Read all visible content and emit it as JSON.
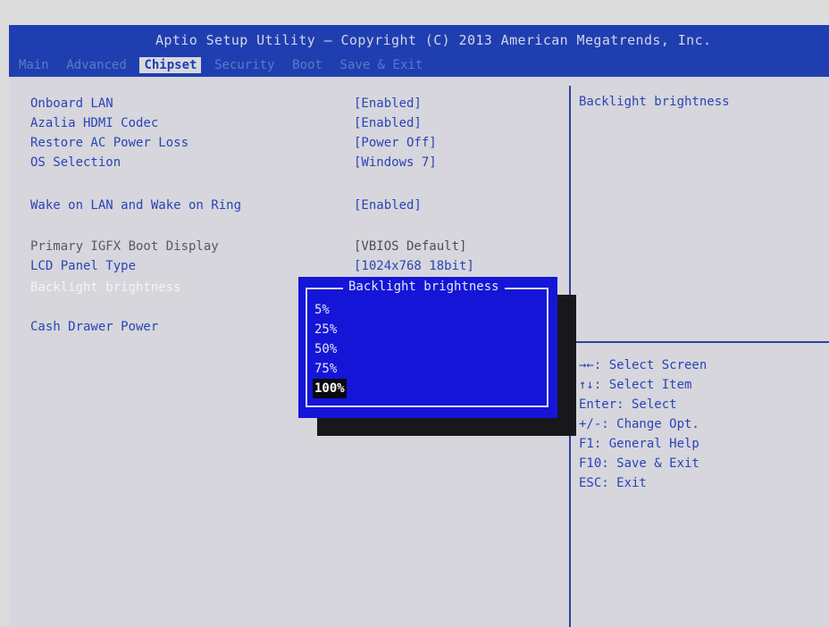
{
  "header": {
    "title": "Aptio Setup Utility – Copyright (C) 2013 American Megatrends, Inc.",
    "tabs": [
      {
        "label": "Main"
      },
      {
        "label": "Advanced"
      },
      {
        "label": "Chipset"
      },
      {
        "label": "Security"
      },
      {
        "label": "Boot"
      },
      {
        "label": "Save & Exit"
      }
    ],
    "active_tab": "Chipset"
  },
  "settings": [
    {
      "label": "Onboard LAN",
      "value": "[Enabled]"
    },
    {
      "label": "Azalia HDMI Codec",
      "value": "[Enabled]"
    },
    {
      "label": "Restore AC Power Loss",
      "value": "[Power Off]"
    },
    {
      "label": "OS Selection",
      "value": "[Windows 7]"
    },
    {
      "label": "Wake on LAN and Wake on Ring",
      "value": "[Enabled]"
    },
    {
      "label": "Primary IGFX Boot Display",
      "value": "[VBIOS Default]"
    },
    {
      "label": "LCD Panel Type",
      "value": "[1024x768  18bit]"
    },
    {
      "label": "Backlight brightness",
      "value": ""
    },
    {
      "label": "Cash Drawer Power",
      "value": ""
    }
  ],
  "help": {
    "title": "Backlight brightness",
    "keys": [
      "→←: Select Screen",
      "↑↓: Select Item",
      "Enter: Select",
      "+/-: Change Opt.",
      "F1: General Help",
      "F10: Save & Exit",
      "ESC: Exit"
    ]
  },
  "popup": {
    "title": "Backlight brightness",
    "options": [
      "5%",
      "25%",
      "50%",
      "75%",
      "100%"
    ],
    "selected": "100%"
  },
  "colors": {
    "header_bg": "#1f3fb0",
    "body_bg": "#d6d6dc",
    "text_blue": "#2a44b6",
    "popup_bg": "#1515d8"
  }
}
